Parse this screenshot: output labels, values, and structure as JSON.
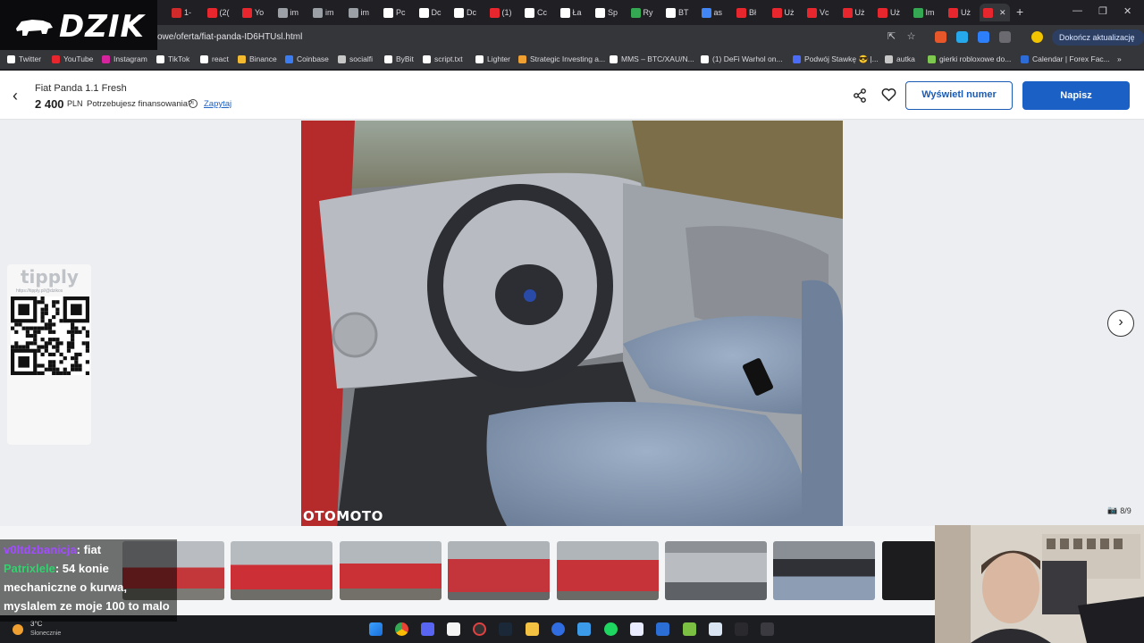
{
  "browser": {
    "tabs": [
      {
        "label": "1-",
        "color": "#d12a2a"
      },
      {
        "label": "(2(",
        "color": "#e8262d"
      },
      {
        "label": "Yo",
        "color": "#e8262d"
      },
      {
        "label": "im",
        "color": "#9aa0a6"
      },
      {
        "label": "im",
        "color": "#9aa0a6"
      },
      {
        "label": "im",
        "color": "#9aa0a6"
      },
      {
        "label": "Pc",
        "color": "#ffffff"
      },
      {
        "label": "Dc",
        "color": "#ffffff"
      },
      {
        "label": "Dc",
        "color": "#ffffff"
      },
      {
        "label": "(1)",
        "color": "#e8262d"
      },
      {
        "label": "Cc",
        "color": "#ffffff"
      },
      {
        "label": "Ła",
        "color": "#ffffff"
      },
      {
        "label": "Sp",
        "color": "#ffffff"
      },
      {
        "label": "Ry",
        "color": "#34a853"
      },
      {
        "label": "BT",
        "color": "#ffffff"
      },
      {
        "label": "as",
        "color": "#4285f4"
      },
      {
        "label": "Bł",
        "color": "#e8262d"
      },
      {
        "label": "Uż",
        "color": "#e8262d"
      },
      {
        "label": "Vc",
        "color": "#e8262d"
      },
      {
        "label": "Uż",
        "color": "#e8262d"
      },
      {
        "label": "Uż",
        "color": "#e8262d"
      },
      {
        "label": "Im",
        "color": "#34a853"
      },
      {
        "label": "Uż",
        "color": "#e8262d"
      }
    ],
    "url": "owe/oferta/fiat-panda-ID6HTUsl.html",
    "update_label": "Dokończ aktualizację",
    "bookmarks": [
      {
        "label": "Twitter",
        "color": "#ffffff"
      },
      {
        "label": "YouTube",
        "color": "#e8262d"
      },
      {
        "label": "Instagram",
        "color": "#d6249f"
      },
      {
        "label": "TikTok",
        "color": "#ffffff"
      },
      {
        "label": "react",
        "color": "#ffffff"
      },
      {
        "label": "Binance",
        "color": "#f3ba2f"
      },
      {
        "label": "Coinbase",
        "color": "#3b7df0"
      },
      {
        "label": "socialfi",
        "color": "#c7c7c7"
      },
      {
        "label": "ByBit",
        "color": "#ffffff"
      },
      {
        "label": "script.txt",
        "color": "#ffffff"
      },
      {
        "label": "Lighter",
        "color": "#ffffff"
      },
      {
        "label": "Strategic Investing a...",
        "color": "#f0a030"
      },
      {
        "label": "MMS – BTC/XAU/N...",
        "color": "#ffffff"
      },
      {
        "label": "(1) DeFi Warhol on...",
        "color": "#ffffff"
      },
      {
        "label": "Podwój Stawkę 😎 |...",
        "color": "#4a6cf7"
      },
      {
        "label": "autka",
        "color": "#c7c7c7"
      },
      {
        "label": "gierki robloxowe do...",
        "color": "#7ec850"
      },
      {
        "label": "Calendar | Forex Fac...",
        "color": "#2d6bd6"
      }
    ]
  },
  "stream_logo": "DZIK",
  "listing": {
    "title": "Fiat Panda 1.1 Fresh",
    "price": "2 400",
    "currency": "PLN",
    "financing_question": "Potrzebujesz finansowania?",
    "ask_link": "Zapytaj",
    "show_number_label": "Wyświetl numer",
    "write_label": "Napisz",
    "photo_counter": "8/9",
    "watermark": "OTOMOTO"
  },
  "tipply": {
    "title": "tipply",
    "url": "https://tipply.pl/@dzikos"
  },
  "chat": [
    {
      "user": "v0ltdzbanicja",
      "user_color": "#a14dff",
      "message": ": fiat"
    },
    {
      "user": "Patrixlele",
      "user_color": "#2fd36d",
      "message": ": 54 konie"
    },
    {
      "user": "",
      "user_color": "#ffffff",
      "message": "mechaniczne o kurwa,"
    },
    {
      "user": "",
      "user_color": "#ffffff",
      "message": "myslalem ze moje 100 to malo"
    }
  ],
  "weather": {
    "temp": "3°C",
    "desc": "Słonecznie"
  },
  "accent_colors": {
    "primary_blue": "#1b60c4",
    "link_blue": "#2363c1"
  }
}
